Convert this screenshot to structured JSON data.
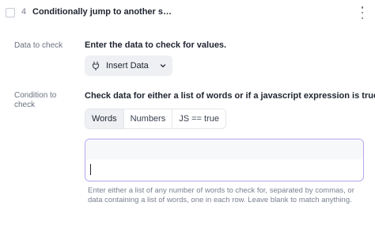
{
  "step": {
    "number": "4",
    "title": "Conditionally jump to another s…"
  },
  "fields": {
    "data_to_check": {
      "label": "Data to check",
      "description": "Enter the data to check for values.",
      "button_label": "Insert Data"
    },
    "condition": {
      "label": "Condition to check",
      "description": "Check data for either a list of words or if a javascript expression is true.",
      "options": [
        "Words",
        "Numbers",
        "JS == true"
      ],
      "selected": "Words",
      "input_value": "",
      "help_text": "Enter either a list of any number of words to check for, separated by commas, or data containing a list of words, one in each row. Leave blank to match anything."
    }
  },
  "colors": {
    "focus_border": "#b9a6ef",
    "button_bg": "#eef0f3"
  },
  "icons": {
    "kebab": "kebab-menu-icon",
    "insert": "plug-icon",
    "dropdown": "chevron-down-icon"
  }
}
